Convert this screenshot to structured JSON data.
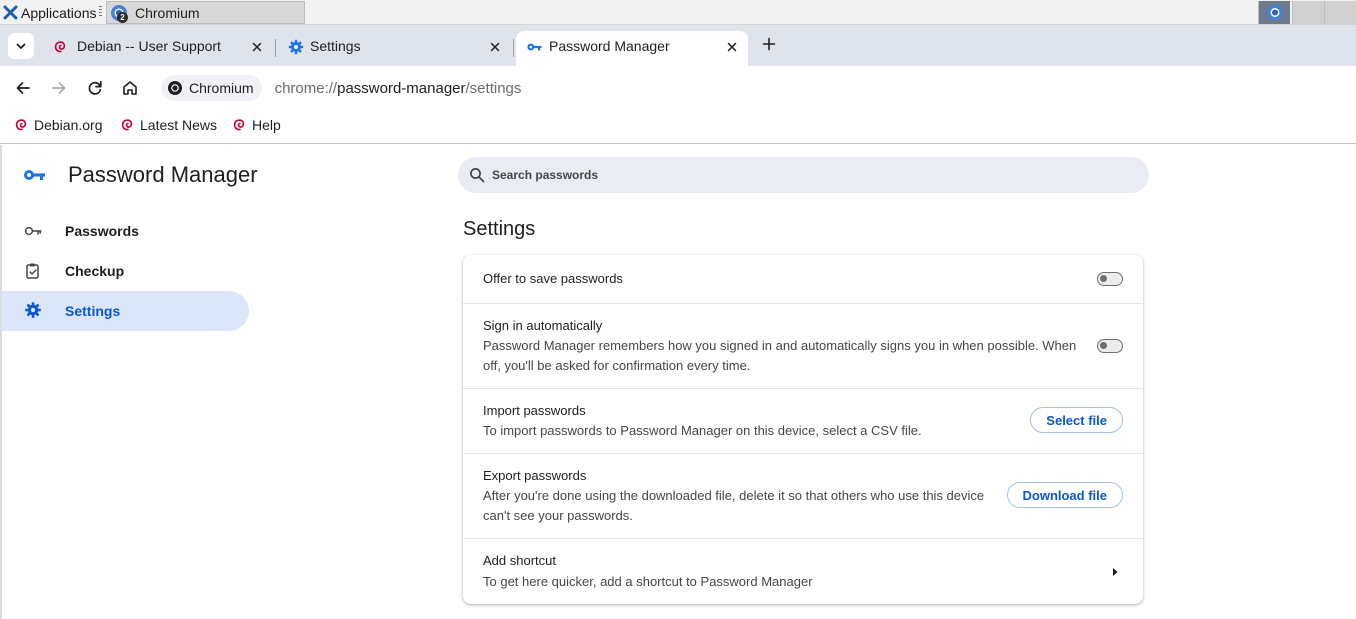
{
  "taskbar": {
    "applications_label": "Applications",
    "task_label": "Chromium",
    "task_badge": "2"
  },
  "tabs": [
    {
      "label": "Debian -- User Support",
      "icon": "debian-swirl-icon",
      "active": false
    },
    {
      "label": "Settings",
      "icon": "gear-icon",
      "active": false
    },
    {
      "label": "Password Manager",
      "icon": "key-icon",
      "active": true
    }
  ],
  "toolbar": {
    "site_chip": "Chromium",
    "url_scheme": "chrome://",
    "url_host": "password-manager",
    "url_path": "/settings"
  },
  "bookmarks": [
    {
      "label": "Debian.org"
    },
    {
      "label": "Latest News"
    },
    {
      "label": "Help"
    }
  ],
  "sidebar": {
    "title": "Password Manager",
    "items": [
      {
        "label": "Passwords",
        "icon": "key-outline-icon"
      },
      {
        "label": "Checkup",
        "icon": "clipboard-check-icon"
      },
      {
        "label": "Settings",
        "icon": "gear-icon",
        "selected": true
      }
    ]
  },
  "search": {
    "placeholder": "Search passwords"
  },
  "main": {
    "heading": "Settings",
    "rows": {
      "offer_save": {
        "title": "Offer to save passwords",
        "toggle_on": false
      },
      "sign_in": {
        "title": "Sign in automatically",
        "desc_line1": "Password Manager remembers how you signed in and automatically signs you in when possible. When",
        "desc_line2": "off, you'll be asked for confirmation every time.",
        "toggle_on": false
      },
      "import": {
        "title": "Import passwords",
        "desc": "To import passwords to Password Manager on this device, select a CSV file.",
        "button": "Select file"
      },
      "export": {
        "title": "Export passwords",
        "desc_line1": "After you're done using the downloaded file, delete it so that others who use this device",
        "desc_line2": "can't see your passwords.",
        "button": "Download file"
      },
      "shortcut": {
        "title": "Add shortcut",
        "desc": "To get here quicker, add a shortcut to Password Manager"
      }
    }
  },
  "colors": {
    "accent": "#0b57d0",
    "debian_red": "#c70036",
    "nav_selected_bg": "#dbe6f8",
    "tabstrip_bg": "#dfe3eb"
  }
}
